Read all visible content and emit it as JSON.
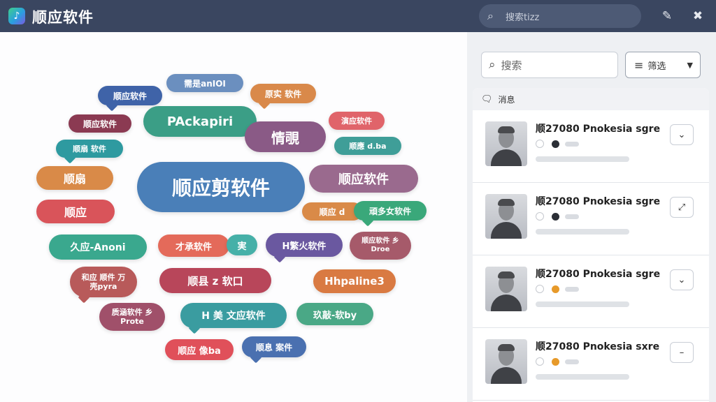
{
  "app": {
    "title": "顺应软件",
    "logo_glyph": "♪"
  },
  "top_search": {
    "placeholder": "搜索tizz",
    "icon": "search-icon"
  },
  "toolbar": {
    "edit_icon": "edit-icon",
    "close_icon": "close-icon"
  },
  "word_cloud": [
    {
      "text": "顺应软件",
      "color": "#3f63a8"
    },
    {
      "text": "需是anIOI",
      "color": "#6b8fbf"
    },
    {
      "text": "原实 软件",
      "color": "#d9894a"
    },
    {
      "text": "顺应软件",
      "color": "#8b3a52"
    },
    {
      "text": "PAckapiri",
      "color": "#3b9e86"
    },
    {
      "text": "情覗",
      "color": "#8a5a86"
    },
    {
      "text": "演应软件",
      "color": "#e0646a"
    },
    {
      "text": "顺扇 软件",
      "color": "#2e9aa0"
    },
    {
      "text": "顺應 d.ba",
      "color": "#3f9e98"
    },
    {
      "text": "顺扇",
      "color": "#d98a48"
    },
    {
      "text": "顺应剪软件",
      "color": "#4a7fb8"
    },
    {
      "text": "顺应软件",
      "color": "#9a6a8e"
    },
    {
      "text": "顺应",
      "color": "#d9545a"
    },
    {
      "text": "顺应 d",
      "color": "#d98a48"
    },
    {
      "text": "頑多女软件",
      "color": "#3aa87a"
    },
    {
      "text": "久应-Anoni",
      "color": "#3aa88e"
    },
    {
      "text": "才承软件",
      "color": "#e46a5a"
    },
    {
      "text": "実",
      "color": "#46b0a8"
    },
    {
      "text": "H繁火软件",
      "color": "#6a58a0"
    },
    {
      "text": "顺应软件 乡 Droe",
      "color": "#a65a6a"
    },
    {
      "text": "和应 顺件 万壳pyra",
      "color": "#b85a5a"
    },
    {
      "text": "顺县 z 软口",
      "color": "#b8465a"
    },
    {
      "text": "Hhpaline3",
      "color": "#d97a42"
    },
    {
      "text": "质涵软件 乡 Prote",
      "color": "#a0506a"
    },
    {
      "text": "H 美 文应软件",
      "color": "#3a9ca0"
    },
    {
      "text": "玖敲-软by",
      "color": "#4aa886"
    },
    {
      "text": "顺应 像ba",
      "color": "#e0505a"
    },
    {
      "text": "顺息 案件",
      "color": "#4a70b0"
    }
  ],
  "panel": {
    "search_placeholder": "搜索",
    "filter_label": "筛选",
    "list_header": "消息",
    "items": [
      {
        "name": "顺27080 Pnokesia sgre",
        "status": "online",
        "action": "chevron-down-icon",
        "action_glyph": "⌄"
      },
      {
        "name": "顺27080 Pnokesia sgre",
        "status": "online",
        "action": "expand-icon",
        "action_glyph": "⤢"
      },
      {
        "name": "顺27080 Pnokesia sgre",
        "status": "away",
        "action": "chevron-down-icon",
        "action_glyph": "⌄"
      },
      {
        "name": "顺27080 Pnokesia sxre",
        "status": "away",
        "action": "minus-icon",
        "action_glyph": "–"
      }
    ]
  }
}
